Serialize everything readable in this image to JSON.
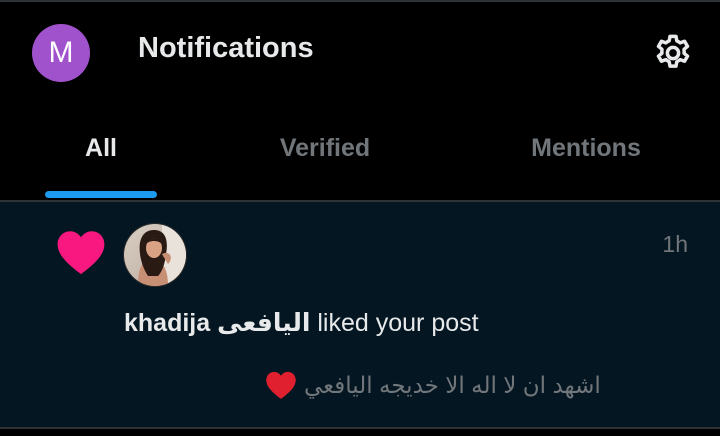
{
  "header": {
    "avatar_letter": "M",
    "title": "Notifications",
    "settings_icon": "gear-icon"
  },
  "tabs": [
    {
      "label": "All",
      "active": true
    },
    {
      "label": "Verified",
      "active": false
    },
    {
      "label": "Mentions",
      "active": false
    }
  ],
  "notification": {
    "type_icon": "heart-icon",
    "user_name": "khadija اليافعى",
    "action": "liked your post",
    "time": "1h",
    "post_text": "اشهد ان لا اله الا خديجه اليافعي",
    "post_emoji": "heart-icon"
  },
  "colors": {
    "background": "#000000",
    "card_background": "#041621",
    "accent": "#1d9bf0",
    "like_heart": "#f91880",
    "avatar_purple": "#a052cc",
    "muted_text": "#71767b",
    "primary_text": "#e7e9ea",
    "emoji_heart": "#e0202f"
  }
}
